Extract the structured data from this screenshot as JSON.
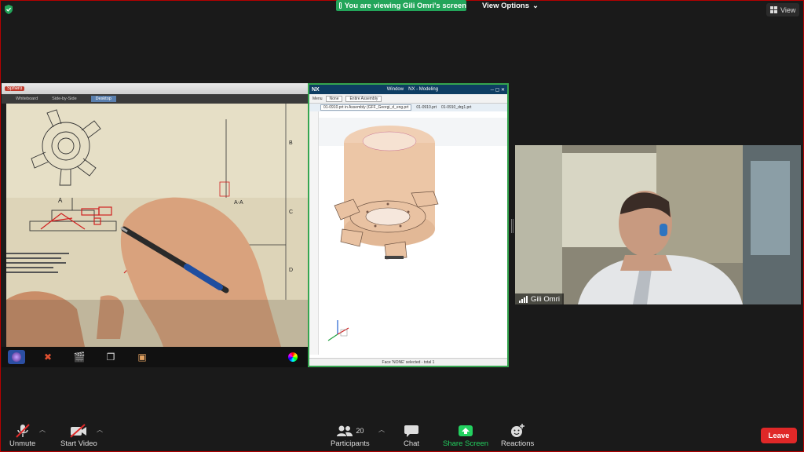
{
  "banner": {
    "text": "You are viewing Gili Omri's screen"
  },
  "view_options": {
    "label": "View Options"
  },
  "view_button": {
    "label": "View"
  },
  "shared_screen": {
    "left_app": {
      "title": "Sphero",
      "tabs": [
        "Whiteboard",
        "Side-by-Side",
        "Desktop"
      ],
      "active_tab": "Desktop",
      "drawing_labels": [
        "A",
        "A-A",
        "B",
        "C",
        "D"
      ]
    },
    "right_app": {
      "title_logo": "NX",
      "window_menu": "Window",
      "title_right": "NX - Modeling",
      "ribbon_left": "Menu",
      "ribbon_field1": "None",
      "ribbon_field2": "Entire Assembly",
      "file_tabs": [
        "01-0910.prt in Assembly (GFF_Georgi_d_eng.prt",
        "01-0910.prt",
        "01-0910_drg1.prt"
      ],
      "status": "Face 'NONE' selected - total 1"
    }
  },
  "participant": {
    "name": "Gili Omri"
  },
  "toolbar": {
    "unmute": "Unmute",
    "start_video": "Start Video",
    "participants": "Participants",
    "participants_count": "20",
    "chat": "Chat",
    "share_screen": "Share Screen",
    "reactions": "Reactions",
    "leave": "Leave"
  },
  "colors": {
    "banner_green": "#23a55a",
    "leave_red": "#e02828",
    "share_green": "#23d160",
    "active_border": "#35a54f"
  }
}
